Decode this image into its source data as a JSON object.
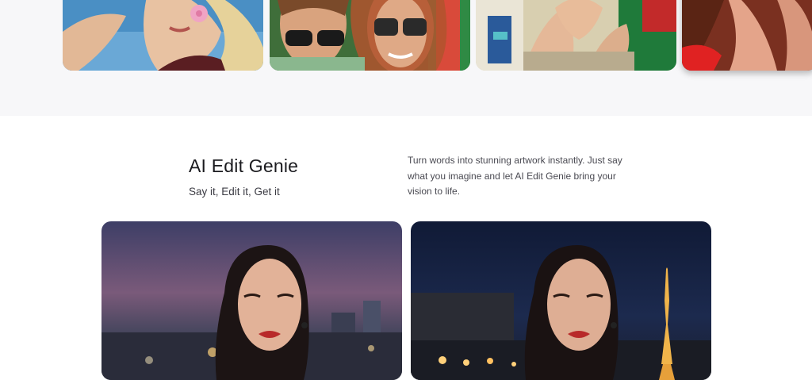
{
  "gallery": {
    "thumbnails": [
      {
        "alt": "woman-with-pink-flower"
      },
      {
        "alt": "friends-in-sunglasses"
      },
      {
        "alt": "hands-making-heart"
      },
      {
        "alt": "woman-in-red"
      }
    ]
  },
  "feature": {
    "title": "AI Edit Genie",
    "subtitle": "Say it, Edit it, Get it",
    "description": "Turn words into stunning artwork instantly. Just say what you imagine and let AI Edit Genie bring your vision to life."
  },
  "comparison": {
    "before": {
      "alt": "portrait-city-dusk"
    },
    "after": {
      "alt": "portrait-eiffel-tower-night"
    }
  },
  "colors": {
    "band_background": "#f7f7f9",
    "title_text": "#1b1b1f",
    "body_text": "#4a4a52"
  }
}
